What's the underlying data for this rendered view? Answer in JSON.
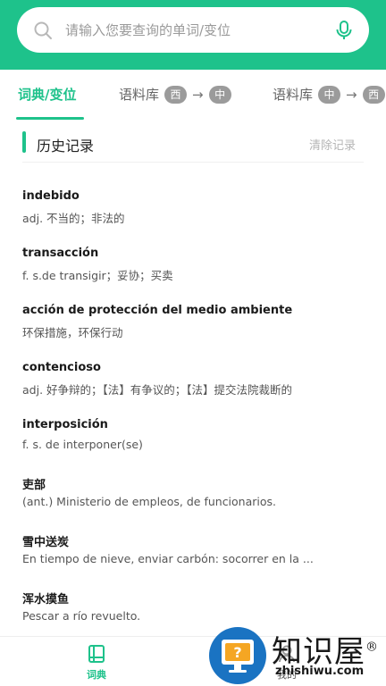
{
  "search": {
    "placeholder": "请输入您要查询的单词/变位"
  },
  "tabs": [
    {
      "label": "词典/变位"
    },
    {
      "label": "语料库",
      "from": "西",
      "to": "中"
    },
    {
      "label": "语料库",
      "from": "中",
      "to": "西"
    }
  ],
  "history": {
    "title": "历史记录",
    "clear_label": "清除记录",
    "items": [
      {
        "word": "indebido",
        "definition": "adj. 不当的；非法的"
      },
      {
        "word": "transacción",
        "definition": "f. s.de transigir；妥协；买卖"
      },
      {
        "word": "acción de protección del medio ambiente",
        "definition": "环保措施，环保行动"
      },
      {
        "word": "contencioso",
        "definition": "adj. 好争辩的；【法】有争议的；【法】提交法院裁断的"
      },
      {
        "word": "interposición",
        "definition": "f. s. de interponer(se)"
      },
      {
        "word": "吏部",
        "definition": "(ant.) Ministerio de empleos, de funcionarios."
      },
      {
        "word": "雪中送炭",
        "definition": "En tiempo de nieve, enviar carbón: socorrer en la ..."
      },
      {
        "word": "浑水摸鱼",
        "definition": "Pescar a río revuelto."
      }
    ]
  },
  "bottom_nav": [
    {
      "label": "词典",
      "icon": "book-icon"
    },
    {
      "label": "我的",
      "icon": "user-icon"
    }
  ],
  "watermark": {
    "title": "知识屋",
    "subtitle": "zhishiwu.com",
    "mark": "®"
  },
  "colors": {
    "accent": "#1ec28b",
    "watermark_blue": "#1a73c2"
  }
}
